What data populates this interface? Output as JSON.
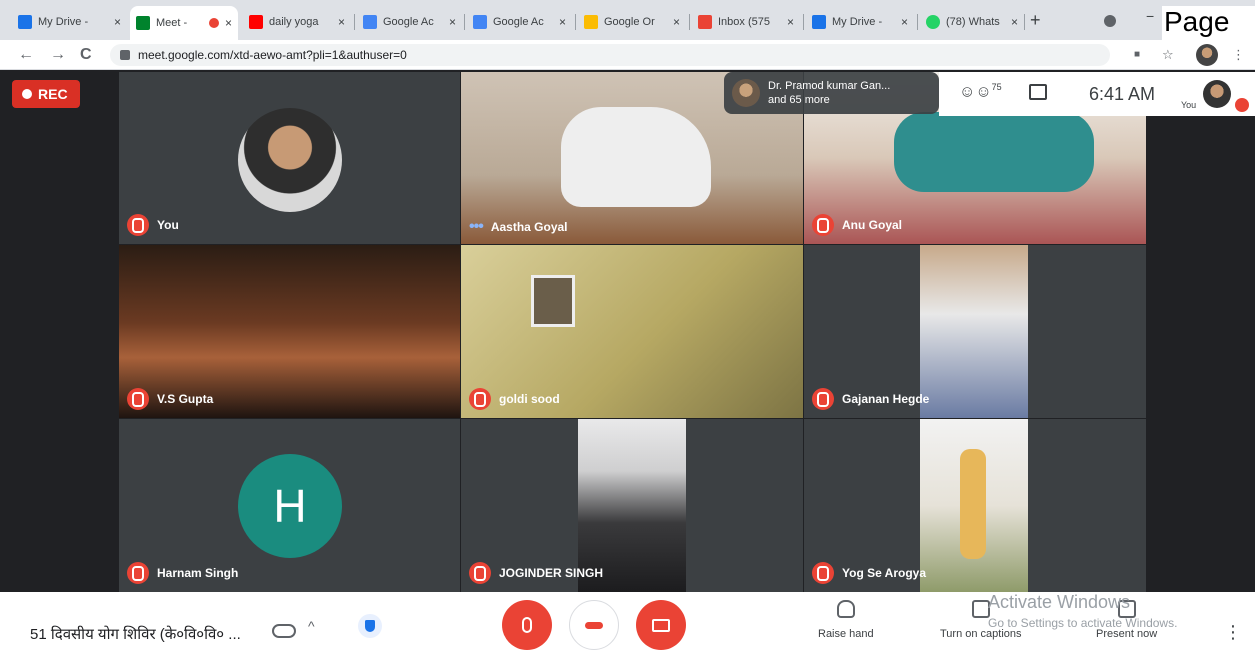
{
  "browser": {
    "tabs": [
      {
        "label": "My Drive -",
        "favicon_color": "#1a73e8"
      },
      {
        "label": "Meet -",
        "favicon_color": "#00832d",
        "active": true
      },
      {
        "label": "daily yoga",
        "favicon_color": "#ff0000"
      },
      {
        "label": "Google Ac",
        "favicon_color": "#4285f4"
      },
      {
        "label": "Google Ac",
        "favicon_color": "#4285f4"
      },
      {
        "label": "Google Or",
        "favicon_color": "#fbbc04"
      },
      {
        "label": "Inbox (575",
        "favicon_color": "#ea4335"
      },
      {
        "label": "My Drive -",
        "favicon_color": "#1a73e8"
      },
      {
        "label": "(78) Whats",
        "favicon_color": "#25d366"
      }
    ],
    "close_glyph": "×",
    "newtab_glyph": "+",
    "page_overlay": "Page N",
    "url": "meet.google.com/xtd-aewo-amt?pli=1&authuser=0",
    "back": "←",
    "forward": "→",
    "reload": "C",
    "camera_glyph": "■",
    "star_glyph": "☆",
    "menu_glyph": "⋮"
  },
  "meet": {
    "rec_label": "REC",
    "people_summary": {
      "line1": "Dr. Pramod kumar Gan...",
      "line2": "and 65 more"
    },
    "participant_count": "75",
    "time": "6:41 AM",
    "self_label": "You",
    "tiles": [
      {
        "name": "You",
        "muted": true,
        "kind": "avatar_photo"
      },
      {
        "name": "Aastha Goyal",
        "muted": false,
        "kind": "video"
      },
      {
        "name": "Anu Goyal",
        "muted": true,
        "kind": "video"
      },
      {
        "name": "V.S Gupta",
        "muted": true,
        "kind": "video"
      },
      {
        "name": "goldi sood",
        "muted": true,
        "kind": "video"
      },
      {
        "name": "Gajanan Hegde",
        "muted": true,
        "kind": "video"
      },
      {
        "name": "Harnam Singh",
        "muted": true,
        "kind": "avatar_letter",
        "letter": "H"
      },
      {
        "name": "JOGINDER SINGH",
        "muted": true,
        "kind": "video"
      },
      {
        "name": "Yog Se Arogya",
        "muted": true,
        "kind": "video"
      }
    ]
  },
  "bottom": {
    "meeting_title": "51 दिवसीय योग शिविर (के०वि०वि० ...",
    "raise_hand": "Raise hand",
    "captions": "Turn on captions",
    "present": "Present now",
    "watermark_title": "Activate Windows",
    "watermark_sub": "Go to Settings to activate Windows.",
    "more_glyph": "⋮",
    "chevron_glyph": "^"
  },
  "colors": {
    "danger": "#ea4335",
    "rec": "#d93025",
    "teal_avatar": "#1a8c7f"
  }
}
